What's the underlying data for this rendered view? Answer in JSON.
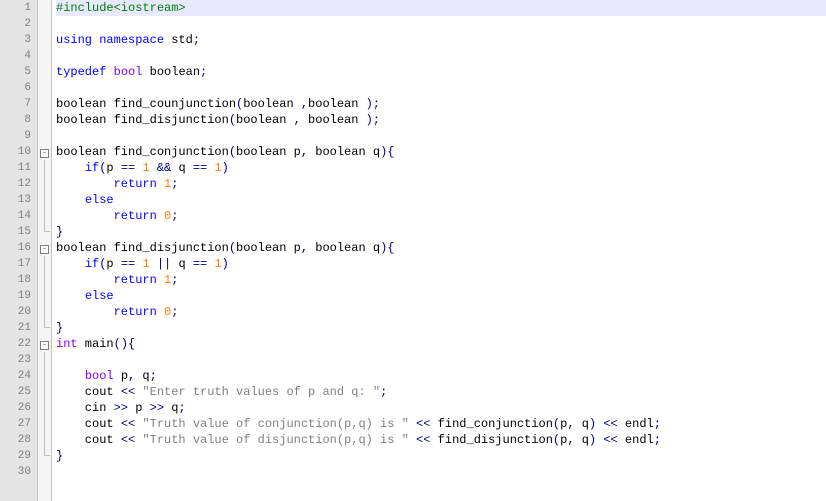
{
  "lines": [
    {
      "n": 1,
      "hl": true,
      "fold": "",
      "tokens": [
        [
          "pp",
          "#include<iostream>"
        ]
      ]
    },
    {
      "n": 2,
      "hl": false,
      "fold": "",
      "tokens": []
    },
    {
      "n": 3,
      "hl": false,
      "fold": "",
      "tokens": [
        [
          "kw",
          "using"
        ],
        [
          "txt",
          " "
        ],
        [
          "kw",
          "namespace"
        ],
        [
          "txt",
          " std"
        ],
        [
          "op",
          ";"
        ]
      ]
    },
    {
      "n": 4,
      "hl": false,
      "fold": "",
      "tokens": []
    },
    {
      "n": 5,
      "hl": false,
      "fold": "",
      "tokens": [
        [
          "kw",
          "typedef"
        ],
        [
          "txt",
          " "
        ],
        [
          "type",
          "bool"
        ],
        [
          "txt",
          " boolean"
        ],
        [
          "op",
          ";"
        ]
      ]
    },
    {
      "n": 6,
      "hl": false,
      "fold": "",
      "tokens": []
    },
    {
      "n": 7,
      "hl": false,
      "fold": "",
      "tokens": [
        [
          "txt",
          "boolean find_counjunction"
        ],
        [
          "op",
          "("
        ],
        [
          "txt",
          "boolean "
        ],
        [
          "op",
          ","
        ],
        [
          "txt",
          "boolean "
        ],
        [
          "op",
          ");"
        ]
      ]
    },
    {
      "n": 8,
      "hl": false,
      "fold": "",
      "tokens": [
        [
          "txt",
          "boolean find_disjunction"
        ],
        [
          "op",
          "("
        ],
        [
          "txt",
          "boolean "
        ],
        [
          "op",
          ","
        ],
        [
          "txt",
          " boolean "
        ],
        [
          "op",
          ");"
        ]
      ]
    },
    {
      "n": 9,
      "hl": false,
      "fold": "",
      "tokens": []
    },
    {
      "n": 10,
      "hl": false,
      "fold": "box",
      "tokens": [
        [
          "txt",
          "boolean find_conjunction"
        ],
        [
          "op",
          "("
        ],
        [
          "txt",
          "boolean p"
        ],
        [
          "op",
          ","
        ],
        [
          "txt",
          " boolean q"
        ],
        [
          "op",
          "){"
        ]
      ]
    },
    {
      "n": 11,
      "hl": false,
      "fold": "vline",
      "tokens": [
        [
          "txt",
          "    "
        ],
        [
          "kw",
          "if"
        ],
        [
          "op",
          "("
        ],
        [
          "txt",
          "p "
        ],
        [
          "op",
          "=="
        ],
        [
          "txt",
          " "
        ],
        [
          "num",
          "1"
        ],
        [
          "txt",
          " "
        ],
        [
          "op",
          "&&"
        ],
        [
          "txt",
          " q "
        ],
        [
          "op",
          "=="
        ],
        [
          "txt",
          " "
        ],
        [
          "num",
          "1"
        ],
        [
          "op",
          ")"
        ]
      ]
    },
    {
      "n": 12,
      "hl": false,
      "fold": "vline",
      "tokens": [
        [
          "txt",
          "        "
        ],
        [
          "kw",
          "return"
        ],
        [
          "txt",
          " "
        ],
        [
          "num",
          "1"
        ],
        [
          "op",
          ";"
        ]
      ]
    },
    {
      "n": 13,
      "hl": false,
      "fold": "vline",
      "tokens": [
        [
          "txt",
          "    "
        ],
        [
          "kw",
          "else"
        ]
      ]
    },
    {
      "n": 14,
      "hl": false,
      "fold": "vline",
      "tokens": [
        [
          "txt",
          "        "
        ],
        [
          "kw",
          "return"
        ],
        [
          "txt",
          " "
        ],
        [
          "num",
          "0"
        ],
        [
          "op",
          ";"
        ]
      ]
    },
    {
      "n": 15,
      "hl": false,
      "fold": "corner",
      "tokens": [
        [
          "op",
          "}"
        ]
      ]
    },
    {
      "n": 16,
      "hl": false,
      "fold": "box",
      "tokens": [
        [
          "txt",
          "boolean find_disjunction"
        ],
        [
          "op",
          "("
        ],
        [
          "txt",
          "boolean p"
        ],
        [
          "op",
          ","
        ],
        [
          "txt",
          " boolean q"
        ],
        [
          "op",
          "){"
        ]
      ]
    },
    {
      "n": 17,
      "hl": false,
      "fold": "vline",
      "tokens": [
        [
          "txt",
          "    "
        ],
        [
          "kw",
          "if"
        ],
        [
          "op",
          "("
        ],
        [
          "txt",
          "p "
        ],
        [
          "op",
          "=="
        ],
        [
          "txt",
          " "
        ],
        [
          "num",
          "1"
        ],
        [
          "txt",
          " "
        ],
        [
          "op",
          "||"
        ],
        [
          "txt",
          " q "
        ],
        [
          "op",
          "=="
        ],
        [
          "txt",
          " "
        ],
        [
          "num",
          "1"
        ],
        [
          "op",
          ")"
        ]
      ]
    },
    {
      "n": 18,
      "hl": false,
      "fold": "vline",
      "tokens": [
        [
          "txt",
          "        "
        ],
        [
          "kw",
          "return"
        ],
        [
          "txt",
          " "
        ],
        [
          "num",
          "1"
        ],
        [
          "op",
          ";"
        ]
      ]
    },
    {
      "n": 19,
      "hl": false,
      "fold": "vline",
      "tokens": [
        [
          "txt",
          "    "
        ],
        [
          "kw",
          "else"
        ]
      ]
    },
    {
      "n": 20,
      "hl": false,
      "fold": "vline",
      "tokens": [
        [
          "txt",
          "        "
        ],
        [
          "kw",
          "return"
        ],
        [
          "txt",
          " "
        ],
        [
          "num",
          "0"
        ],
        [
          "op",
          ";"
        ]
      ]
    },
    {
      "n": 21,
      "hl": false,
      "fold": "corner",
      "tokens": [
        [
          "op",
          "}"
        ]
      ]
    },
    {
      "n": 22,
      "hl": false,
      "fold": "box",
      "tokens": [
        [
          "type",
          "int"
        ],
        [
          "txt",
          " main"
        ],
        [
          "op",
          "(){"
        ]
      ]
    },
    {
      "n": 23,
      "hl": false,
      "fold": "vline",
      "tokens": []
    },
    {
      "n": 24,
      "hl": false,
      "fold": "vline",
      "tokens": [
        [
          "txt",
          "    "
        ],
        [
          "type",
          "bool"
        ],
        [
          "txt",
          " p"
        ],
        [
          "op",
          ","
        ],
        [
          "txt",
          " q"
        ],
        [
          "op",
          ";"
        ]
      ]
    },
    {
      "n": 25,
      "hl": false,
      "fold": "vline",
      "tokens": [
        [
          "txt",
          "    cout "
        ],
        [
          "op",
          "<<"
        ],
        [
          "txt",
          " "
        ],
        [
          "str",
          "\"Enter truth values of p and q: \""
        ],
        [
          "op",
          ";"
        ]
      ]
    },
    {
      "n": 26,
      "hl": false,
      "fold": "vline",
      "tokens": [
        [
          "txt",
          "    cin "
        ],
        [
          "op",
          ">>"
        ],
        [
          "txt",
          " p "
        ],
        [
          "op",
          ">>"
        ],
        [
          "txt",
          " q"
        ],
        [
          "op",
          ";"
        ]
      ]
    },
    {
      "n": 27,
      "hl": false,
      "fold": "vline",
      "tokens": [
        [
          "txt",
          "    cout "
        ],
        [
          "op",
          "<<"
        ],
        [
          "txt",
          " "
        ],
        [
          "str",
          "\"Truth value of conjunction(p,q) is \""
        ],
        [
          "txt",
          " "
        ],
        [
          "op",
          "<<"
        ],
        [
          "txt",
          " find_conjunction"
        ],
        [
          "op",
          "("
        ],
        [
          "txt",
          "p"
        ],
        [
          "op",
          ","
        ],
        [
          "txt",
          " q"
        ],
        [
          "op",
          ")"
        ],
        [
          "txt",
          " "
        ],
        [
          "op",
          "<<"
        ],
        [
          "txt",
          " endl"
        ],
        [
          "op",
          ";"
        ]
      ]
    },
    {
      "n": 28,
      "hl": false,
      "fold": "vline",
      "tokens": [
        [
          "txt",
          "    cout "
        ],
        [
          "op",
          "<<"
        ],
        [
          "txt",
          " "
        ],
        [
          "str",
          "\"Truth value of disjunction(p,q) is \""
        ],
        [
          "txt",
          " "
        ],
        [
          "op",
          "<<"
        ],
        [
          "txt",
          " find_disjunction"
        ],
        [
          "op",
          "("
        ],
        [
          "txt",
          "p"
        ],
        [
          "op",
          ","
        ],
        [
          "txt",
          " q"
        ],
        [
          "op",
          ")"
        ],
        [
          "txt",
          " "
        ],
        [
          "op",
          "<<"
        ],
        [
          "txt",
          " endl"
        ],
        [
          "op",
          ";"
        ]
      ]
    },
    {
      "n": 29,
      "hl": false,
      "fold": "corner",
      "tokens": [
        [
          "op",
          "}"
        ]
      ]
    },
    {
      "n": 30,
      "hl": false,
      "fold": "",
      "tokens": []
    }
  ]
}
